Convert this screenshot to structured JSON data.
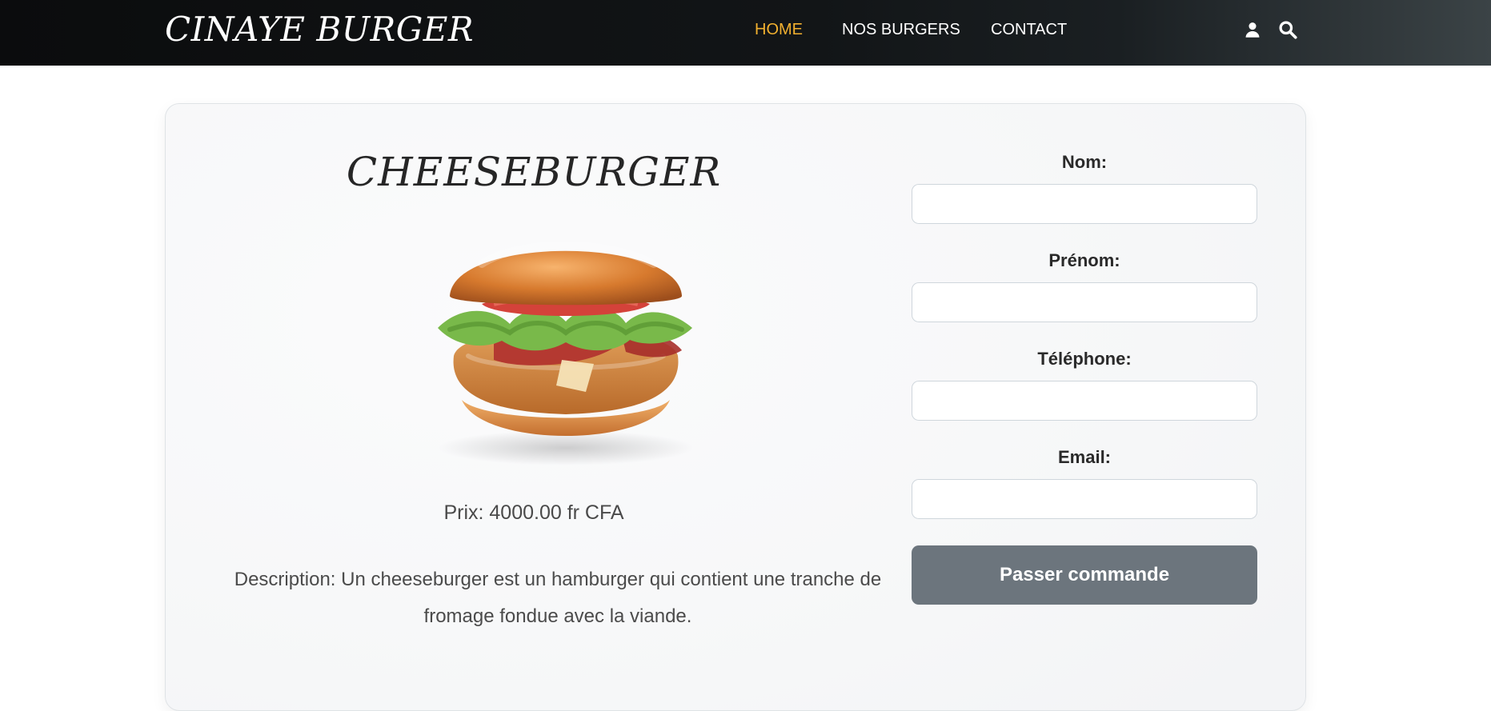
{
  "header": {
    "brand": "CINAYE BURGER",
    "nav": {
      "home": "HOME",
      "burgers": "NOS BURGERS",
      "contact": "CONTACT"
    },
    "icons": {
      "user": "user-icon",
      "search": "search-icon"
    }
  },
  "product": {
    "title": "CHEESEBURGER",
    "image_icon": "burger-image",
    "price": "Prix: 4000.00 fr CFA",
    "description": "Description: Un cheeseburger est un hamburger qui contient une tranche de fromage fondue avec la viande."
  },
  "form": {
    "fields": [
      {
        "label": "Nom:",
        "value": "",
        "placeholder": ""
      },
      {
        "label": "Prénom:",
        "value": "",
        "placeholder": ""
      },
      {
        "label": "Téléphone:",
        "value": "",
        "placeholder": ""
      },
      {
        "label": "Email:",
        "value": "",
        "placeholder": ""
      }
    ],
    "submit_label": "Passer commande"
  },
  "colors": {
    "accent": "#f2b02f",
    "button": "#6c757d"
  }
}
